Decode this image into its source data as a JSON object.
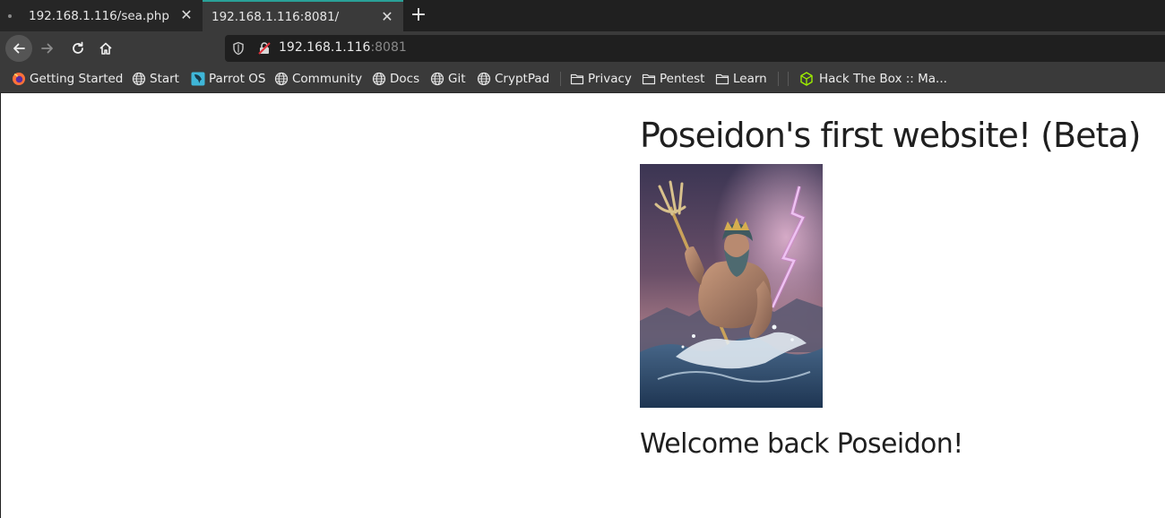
{
  "browser": {
    "tabs": [
      {
        "title": "192.168.1.116/sea.php",
        "active": false
      },
      {
        "title": "192.168.1.116:8081/",
        "active": true
      }
    ],
    "new_tab_icon": "plus-icon",
    "close_icon": "close-icon",
    "url_host": "192.168.1.116",
    "url_port": ":8081",
    "accent_color": "#2aa198",
    "bookmarks": [
      {
        "label": "Getting Started",
        "icon": "firefox-icon"
      },
      {
        "label": "Start",
        "icon": "globe-icon"
      },
      {
        "label": "Parrot OS",
        "icon": "parrot-icon"
      },
      {
        "label": "Community",
        "icon": "globe-icon"
      },
      {
        "label": "Docs",
        "icon": "globe-icon"
      },
      {
        "label": "Git",
        "icon": "globe-icon"
      },
      {
        "label": "CryptPad",
        "icon": "globe-icon"
      },
      {
        "label": "Privacy",
        "icon": "folder-icon"
      },
      {
        "label": "Pentest",
        "icon": "folder-icon"
      },
      {
        "label": "Learn",
        "icon": "folder-icon"
      },
      {
        "label": "Hack The Box :: Ma...",
        "icon": "htb-cube-icon"
      }
    ]
  },
  "page": {
    "heading": "Poseidon's first website! (Beta)",
    "welcome": "Welcome back Poseidon!"
  }
}
